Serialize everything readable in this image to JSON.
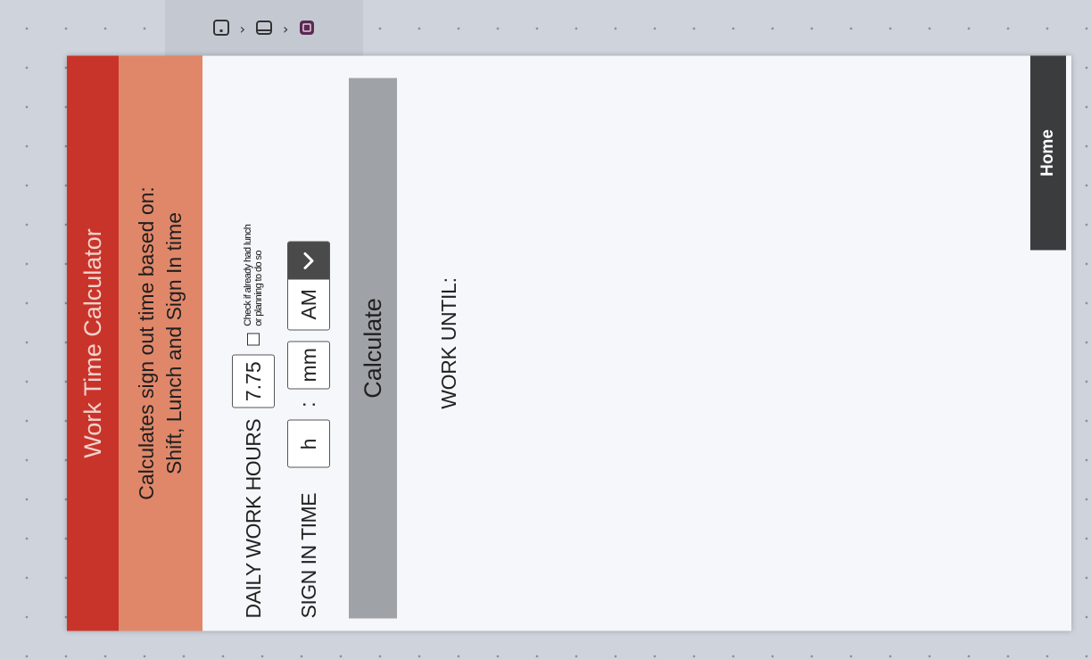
{
  "app": {
    "title": "Work Time Calculator",
    "subtitle_line1": "Calculates sign out time based on:",
    "subtitle_line2": "Shift, Lunch and Sign In time"
  },
  "form": {
    "daily_hours_label": "DAILY WORK HOURS",
    "daily_hours_value": "7.75",
    "lunch_checkbox_note": "Check if already had lunch or planning to do so",
    "lunch_checked": false,
    "sign_in_label": "SIGN IN TIME",
    "hour_placeholder": "h",
    "colon": ":",
    "minute_placeholder": "mm",
    "ampm_value": "AM",
    "calculate_label": "Calculate"
  },
  "result": {
    "label": "WORK UNTIL:"
  },
  "nav": {
    "home_label": "Home"
  },
  "colors": {
    "title_bg": "#c9342a",
    "subtitle_bg": "#e0876a",
    "button_bg": "#9fa2a6",
    "home_bg": "#3b3c3e"
  },
  "icons": {
    "toolbar": [
      "page-icon",
      "chevron-right-icon",
      "frame-icon",
      "chevron-right-icon",
      "app-icon"
    ],
    "dropdown": "chevron-down-icon"
  }
}
